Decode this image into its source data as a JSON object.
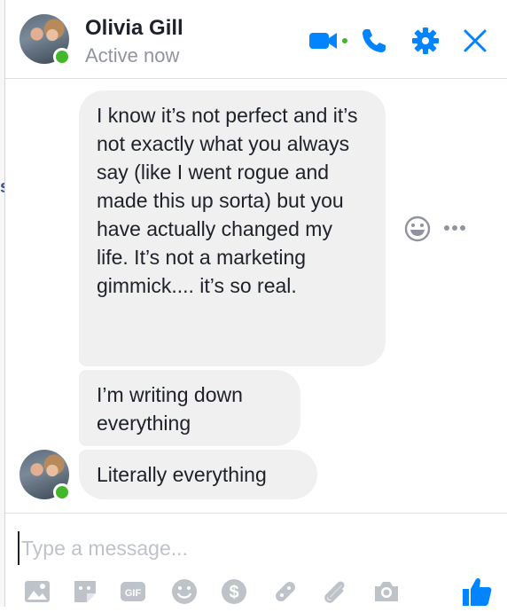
{
  "header": {
    "name": "Olivia Gill",
    "status": "Active now",
    "icons": [
      "video-camera-icon",
      "phone-icon",
      "gear-icon",
      "close-icon"
    ],
    "accent": "#0084ff",
    "presence_color": "#42b72a"
  },
  "messages": [
    {
      "text": "I know it’s not perfect and it’s not exactly what you always say (like I went rogue and made this up sorta) but you have actually changed my life. It’s not a marketing gimmick.... it’s so real."
    },
    {
      "text": "I’m writing down everything"
    },
    {
      "text": "Literally everything"
    }
  ],
  "message_actions": [
    "emoji-reaction-icon",
    "more-options-icon"
  ],
  "composer": {
    "placeholder": "Type a message...",
    "tools": [
      "photo-icon",
      "sticker-icon",
      "gif-icon",
      "emoji-icon",
      "payment-icon",
      "game-icon",
      "attachment-icon",
      "camera-icon",
      "like-icon"
    ]
  },
  "bubble_color": "#f1f0f0"
}
